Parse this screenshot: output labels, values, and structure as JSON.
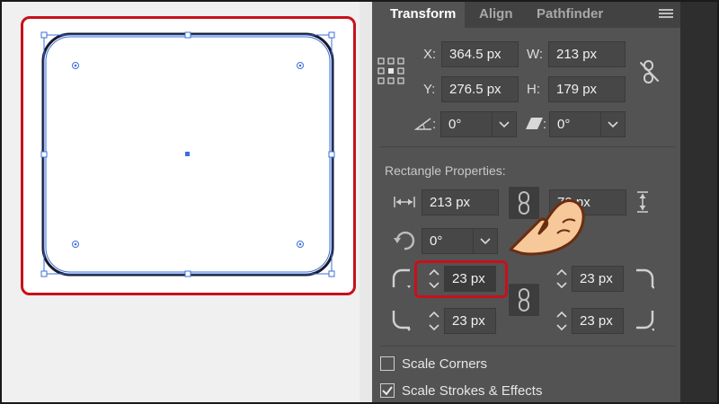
{
  "transform_panel": {
    "tabs": [
      {
        "label": "Transform",
        "active": true
      },
      {
        "label": "Align",
        "active": false
      },
      {
        "label": "Pathfinder",
        "active": false
      }
    ],
    "x_label": "X:",
    "x_value": "364.5 px",
    "y_label": "Y:",
    "y_value": "276.5 px",
    "w_label": "W:",
    "w_value": "213 px",
    "h_label": "H:",
    "h_value": "179 px",
    "rotate_label": ":",
    "rotate_value": "0°",
    "shear_label": ":",
    "shear_value": "0°"
  },
  "rectangle_properties": {
    "heading": "Rectangle Properties:",
    "width_value": "213 px",
    "height_value": "79 px",
    "angle_value": "0°",
    "corner_top_left": "23 px",
    "corner_top_right": "23 px",
    "corner_bottom_left": "23 px",
    "corner_bottom_right": "23 px"
  },
  "options": {
    "scale_corners_label": "Scale Corners",
    "scale_corners_checked": false,
    "scale_strokes_label": "Scale Strokes & Effects",
    "scale_strokes_checked": true
  },
  "colors": {
    "panel_bg": "#535353",
    "highlight_red": "#c8101a",
    "selection_blue": "#3b6fd9",
    "stroke": "#1a1a2e"
  }
}
